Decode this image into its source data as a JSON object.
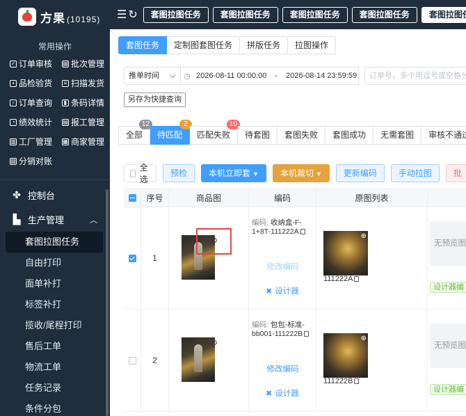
{
  "brand": {
    "name": "方果",
    "count": "(10195)"
  },
  "sidebar": {
    "quick_title": "常用操作",
    "quick_items": [
      "订单审核",
      "批次管理",
      "品检验货",
      "扫描发货",
      "订单查询",
      "条码详情",
      "绩效统计",
      "报工管理",
      "工厂管理",
      "商家管理",
      "分销对账"
    ],
    "menu": [
      {
        "label": "控制台",
        "icon": "dashboard-icon"
      },
      {
        "label": "生产管理",
        "icon": "production-icon"
      }
    ],
    "submenu": [
      "套图拉图任务",
      "自由打印",
      "面单补打",
      "标签补打",
      "揽收/尾程打印",
      "售后工单",
      "物流工单",
      "任务记录",
      "条件分包"
    ],
    "active_submenu": "套图拉图任务"
  },
  "header": {
    "tabs": [
      "套图拉图任务",
      "套图拉图任务",
      "套图拉图任务",
      "套图拉图任务",
      "套图拉图任"
    ]
  },
  "subtabs": [
    "套图任务",
    "定制图套图任务",
    "拼版任务",
    "拉图操作"
  ],
  "filters": {
    "time_select": "推单时间",
    "date_start": "2026-08-11 00:00:00",
    "date_sep": "-",
    "date_end": "2026-08-14 23:59:59",
    "search_placeholder": "订单号，多个用逗号或空格分隔",
    "save_quick": "另存为快捷查询"
  },
  "status_tabs": [
    {
      "label": "全部",
      "badge": "12",
      "badge_color": "#909399"
    },
    {
      "label": "待匹配",
      "badge": "2",
      "badge_color": "#e6a23c"
    },
    {
      "label": "匹配失败",
      "badge": "10",
      "badge_color": "#f56c6c"
    },
    {
      "label": "待套图",
      "badge": ""
    },
    {
      "label": "套图失败",
      "badge": ""
    },
    {
      "label": "套图成功",
      "badge": ""
    },
    {
      "label": "无需套图",
      "badge": ""
    },
    {
      "label": "审核不通过",
      "badge": ""
    }
  ],
  "active_status": "待匹配",
  "actions": {
    "select_all": "全选",
    "precheck": "预检",
    "local_fit": "本机立即套",
    "local_cut": "本机裁切",
    "update_code": "更新编码",
    "manual_pull": "手动拉图",
    "batch": "批"
  },
  "table": {
    "headers": [
      "序号",
      "商品图",
      "编码",
      "原图列表"
    ],
    "code_label": "编码:",
    "edit_code": "修改编码",
    "designer": "设计器",
    "no_preview": "无预览图",
    "design_tag": "设计器编",
    "rows": [
      {
        "seq": "1",
        "checked": true,
        "code": "收纳盒-F-1+8T-111222A",
        "edit_enabled": false,
        "orig_caption": "111222A"
      },
      {
        "seq": "2",
        "checked": false,
        "code": "包包-标准-bb001-111222B",
        "edit_enabled": true,
        "orig_caption": "111222B"
      }
    ]
  },
  "colors": {
    "sidebar_bg": "#1f2d3d",
    "primary": "#409eff",
    "warning": "#e6a23c",
    "danger": "#f56c6c",
    "success": "#67c23a",
    "highlight_box": "#e64545"
  }
}
